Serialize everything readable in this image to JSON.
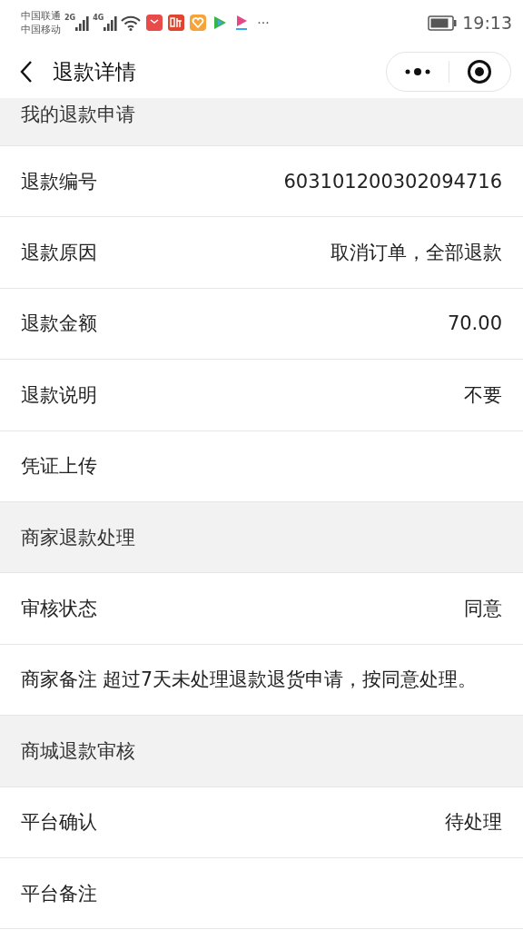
{
  "status_bar": {
    "carriers": [
      "中国联通",
      "中国移动"
    ],
    "networks": [
      "2G",
      "4G"
    ],
    "more": "···",
    "time": "19:13"
  },
  "nav": {
    "title": "退款详情"
  },
  "items": [
    {
      "kind": "section",
      "label": "我的退款申请"
    },
    {
      "kind": "field",
      "label": "退款编号",
      "value": "603101200302094716"
    },
    {
      "kind": "field",
      "label": "退款原因",
      "value": "取消订单，全部退款"
    },
    {
      "kind": "field",
      "label": "退款金额",
      "value": "70.00"
    },
    {
      "kind": "field",
      "label": "退款说明",
      "value": "不要"
    },
    {
      "kind": "field",
      "label": "凭证上传"
    },
    {
      "kind": "section",
      "label": "商家退款处理"
    },
    {
      "kind": "field",
      "label": "审核状态",
      "value": "同意"
    },
    {
      "kind": "note",
      "label": "商家备注",
      "value": "超过7天未处理退款退货申请，按同意处理。"
    },
    {
      "kind": "section",
      "label": "商城退款审核"
    },
    {
      "kind": "field",
      "label": "平台确认",
      "value": "待处理"
    },
    {
      "kind": "field",
      "label": "平台备注"
    }
  ]
}
